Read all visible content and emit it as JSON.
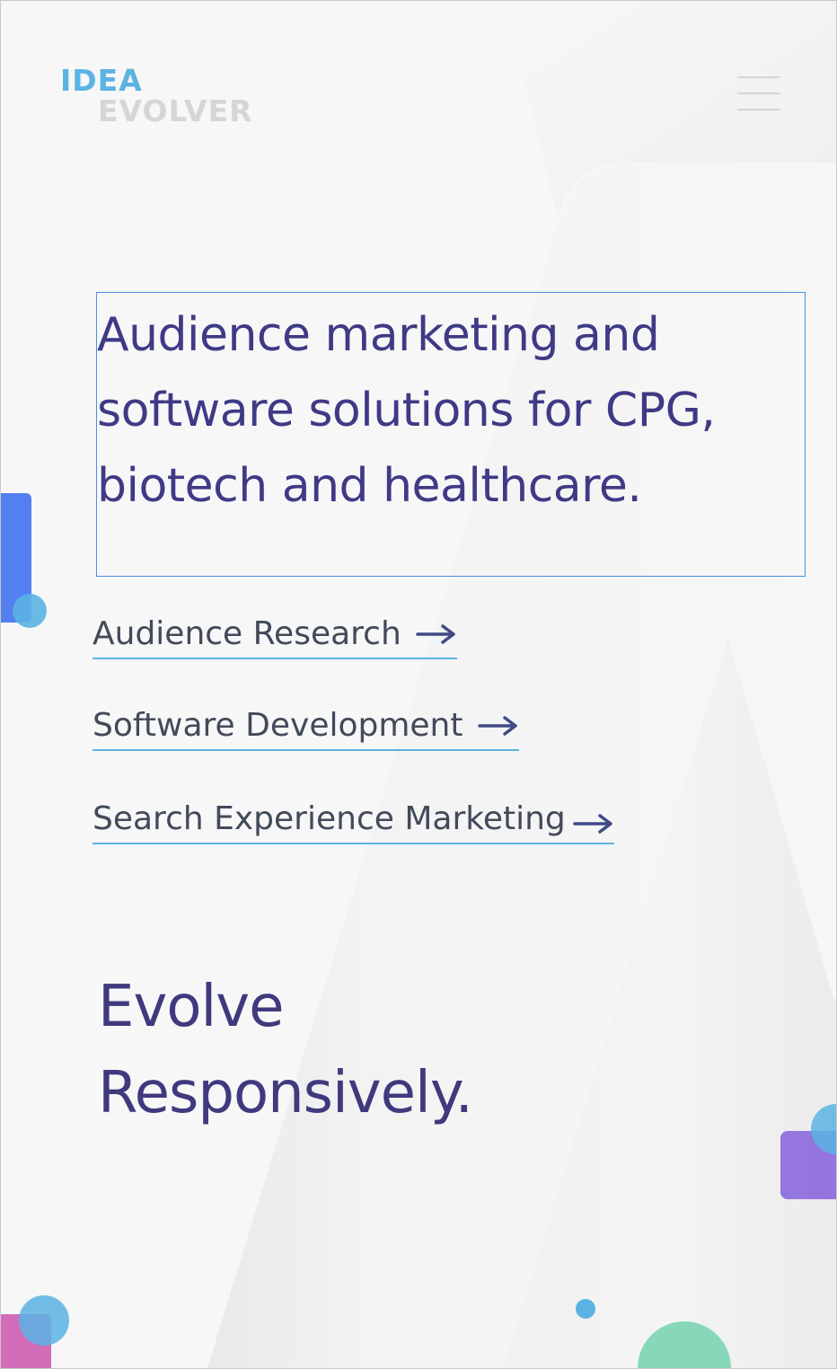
{
  "header": {
    "logo": {
      "line1": "IDEA",
      "line2": "EVOLVER",
      "colors": {
        "idea": "#5bb3e3",
        "evolver": "#d6d6d6"
      }
    },
    "menu_icon": "hamburger-icon"
  },
  "hero": {
    "headline": "Audience marketing and software solutions for CPG, biotech and healthcare.",
    "services": [
      {
        "label": "Audience Research",
        "icon": "arrow-right-icon"
      },
      {
        "label": "Software Development",
        "icon": "arrow-right-icon"
      },
      {
        "label": "Search Experience Marketing",
        "icon": "arrow-right-icon"
      }
    ],
    "tagline": {
      "line1": "Evolve",
      "line2": "Responsively."
    }
  },
  "colors": {
    "headline": "#3f3a86",
    "link_text": "#424a5a",
    "link_underline": "#5bb3e3",
    "arrow": "#3f4a86",
    "accent_blue": "#4a78f0",
    "accent_cyan": "#5bb3e3",
    "accent_purple": "#8e6fdc",
    "accent_pink": "#d064b4",
    "accent_green": "#7fd6b4"
  }
}
